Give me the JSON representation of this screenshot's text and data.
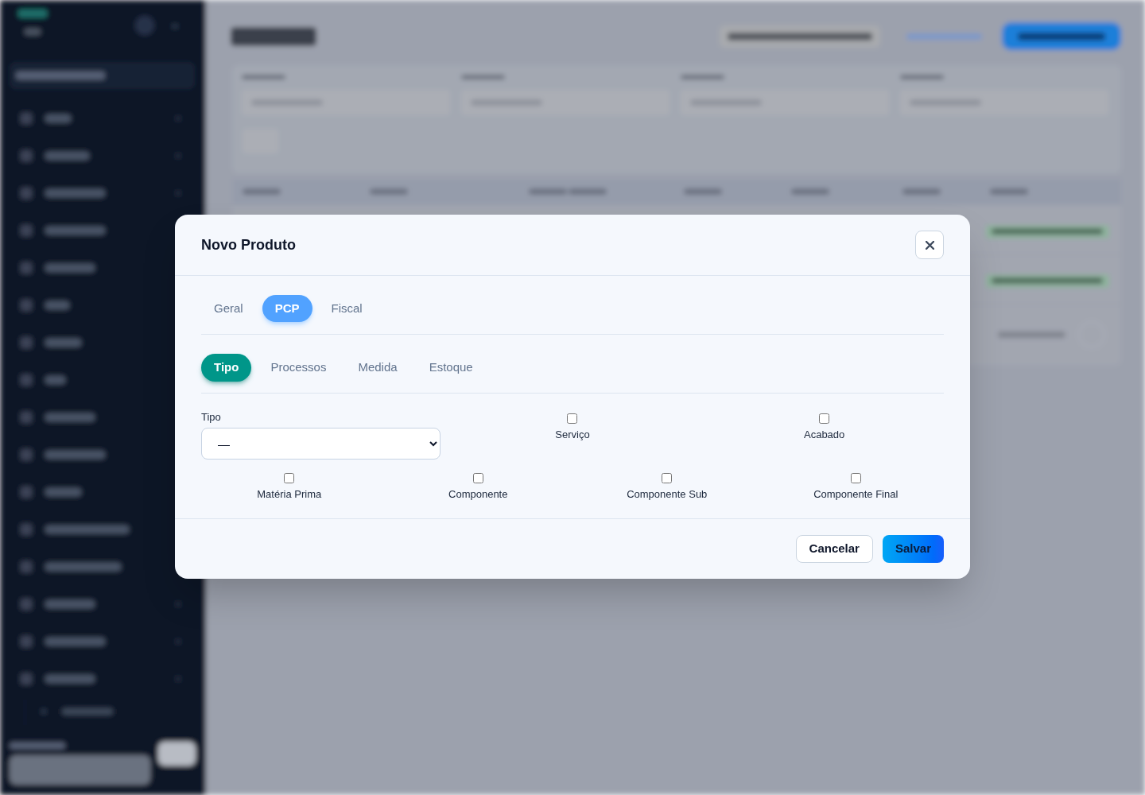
{
  "dialog": {
    "title": "Novo Produto",
    "tabs": [
      {
        "label": "Geral",
        "selected": false
      },
      {
        "label": "PCP",
        "selected": true
      },
      {
        "label": "Fiscal",
        "selected": false
      }
    ],
    "subtabs": [
      {
        "label": "Tipo",
        "selected": true
      },
      {
        "label": "Processos",
        "selected": false
      },
      {
        "label": "Medida",
        "selected": false
      },
      {
        "label": "Estoque",
        "selected": false
      }
    ],
    "form": {
      "select": {
        "label": "Tipo",
        "value": "—"
      },
      "top_checkboxes": [
        {
          "label": "Serviço",
          "checked": false
        },
        {
          "label": "Acabado",
          "checked": false
        }
      ],
      "bottom_checkboxes": [
        {
          "label": "Matéria Prima",
          "checked": false
        },
        {
          "label": "Componente",
          "checked": false
        },
        {
          "label": "Componente Sub",
          "checked": false
        },
        {
          "label": "Componente Final",
          "checked": false
        }
      ]
    },
    "buttons": [
      {
        "label": "Cancelar",
        "kind": "secondary"
      },
      {
        "label": "Salvar",
        "kind": "primary"
      }
    ]
  }
}
